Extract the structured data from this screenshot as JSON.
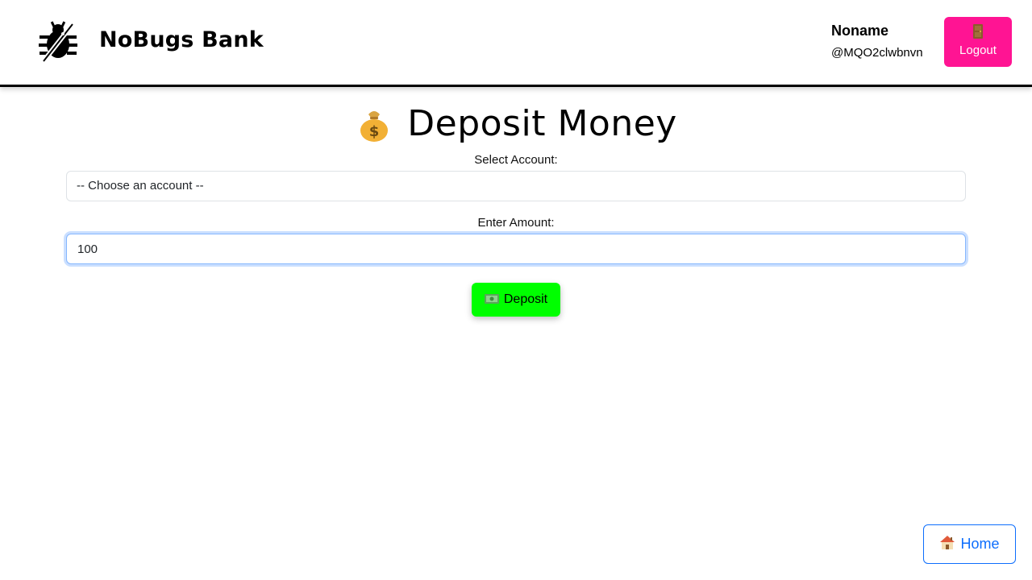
{
  "header": {
    "brand": "NoBugs Bank",
    "logo_icon": "no-bug-icon",
    "user": {
      "name": "Noname",
      "handle": "@MQO2clwbnvn"
    },
    "logout": {
      "icon": "door-icon",
      "label": "Logout",
      "color": "#ff1493"
    }
  },
  "main": {
    "title_icon": "money-bag-icon",
    "title": "Deposit Money",
    "account": {
      "label": "Select Account:",
      "selected": "-- Choose an account --"
    },
    "amount": {
      "label": "Enter Amount:",
      "value": "100"
    },
    "deposit_button": {
      "icon": "cash-icon",
      "label": "Deposit",
      "color": "#00ff00"
    }
  },
  "footer": {
    "home_button": {
      "icon": "house-icon",
      "label": "Home",
      "color": "#0d6efd"
    }
  }
}
